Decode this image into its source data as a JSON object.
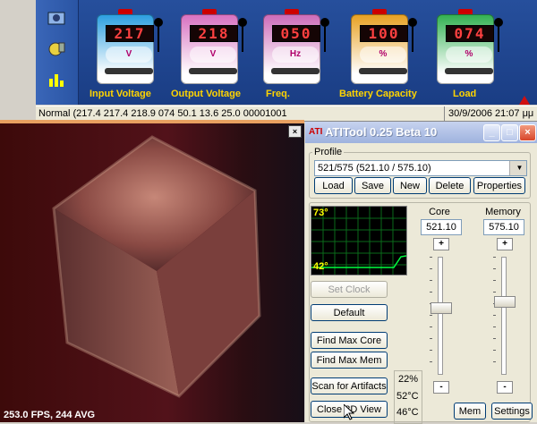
{
  "ups": {
    "meters": [
      {
        "digits": "217",
        "unit": "V",
        "label": "Input Voltage",
        "theme": "#2a9ee0"
      },
      {
        "digits": "218",
        "unit": "V",
        "label": "Output Voltage",
        "theme": "#d870c0"
      },
      {
        "digits": "050",
        "unit": "Hz",
        "label": "Freq.",
        "theme": "#cc6ab8"
      },
      {
        "digits": "100",
        "unit": "%",
        "label": "Battery Capacity",
        "theme": "#e8a020"
      },
      {
        "digits": "074",
        "unit": "%",
        "label": "Load",
        "theme": "#30b050"
      }
    ],
    "status_left": "Normal  (217.4 217.4 218.9 074 50.1 13.6 25.0 00001001",
    "status_right": "30/9/2006 21:07 μμ"
  },
  "render": {
    "fps": "253.0 FPS, 244 AVG",
    "close_glyph": "×"
  },
  "ati": {
    "title": "ATITool 0.25 Beta 10",
    "profile_label": "Profile",
    "profile_value": "521/575 (521.10 / 575.10)",
    "buttons": {
      "load": "Load",
      "save": "Save",
      "new": "New",
      "delete": "Delete",
      "properties": "Properties"
    },
    "graph_max": "73°",
    "graph_min": "42°",
    "core_label": "Core",
    "core_value": "521.10",
    "memory_label": "Memory",
    "memory_value": "575.10",
    "plus": "+",
    "minus": "-",
    "set_clock": "Set Clock",
    "default": "Default",
    "find_max_core": "Find Max Core",
    "find_max_mem": "Find Max Mem",
    "scan_artifacts": "Scan for Artifacts",
    "close_3d_view": "Close 3D View",
    "mem": "Mem",
    "settings": "Settings",
    "temps": [
      "22%",
      "52°C",
      "46°C"
    ],
    "title_buttons": {
      "minimize": "_",
      "maximize": "□",
      "close": "×"
    }
  }
}
